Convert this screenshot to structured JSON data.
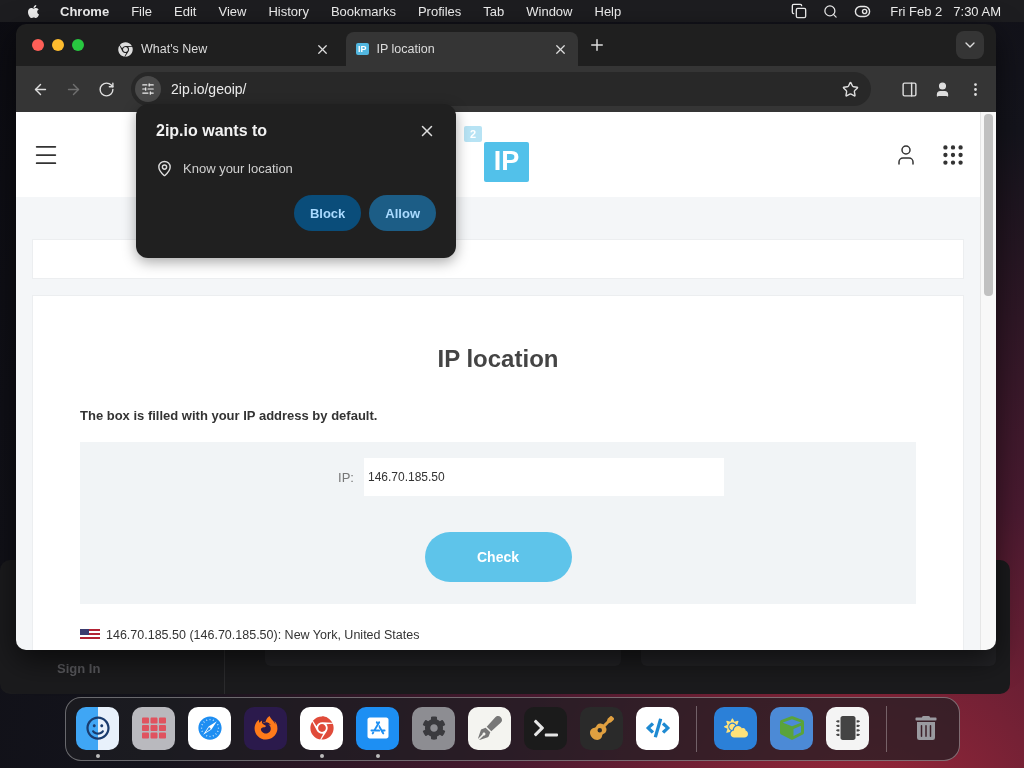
{
  "menubar": {
    "app": "Chrome",
    "menus": [
      "File",
      "Edit",
      "View",
      "History",
      "Bookmarks",
      "Profiles",
      "Tab",
      "Window",
      "Help"
    ],
    "date": "Fri Feb 2",
    "time": "7:30 AM"
  },
  "browser": {
    "tabs": [
      {
        "title": "What's New",
        "selected": false
      },
      {
        "title": "IP location",
        "selected": true,
        "favicon_text": "IP"
      }
    ],
    "nav": [
      {
        "kind": "back",
        "disabled": false
      },
      {
        "kind": "forward",
        "disabled": true
      },
      {
        "kind": "reload",
        "disabled": false
      }
    ],
    "address": "2ip.io/geoip/"
  },
  "permission_prompt": {
    "title": "2ip.io wants to",
    "permission": "Know your location",
    "buttons": [
      {
        "label": "Block",
        "kind": "block"
      },
      {
        "label": "Allow",
        "kind": "allow"
      }
    ]
  },
  "page": {
    "logo": {
      "small": "2",
      "large": "IP"
    },
    "title": "IP location",
    "note": "The box is filled with your IP address by default.",
    "ip_label": "IP:",
    "ip_value": "146.70.185.50",
    "check_button": "Check",
    "result": "146.70.185.50 (146.70.185.50): New York, United States"
  },
  "background_window": {
    "sign_in": "Sign In"
  },
  "dock": {
    "items": [
      {
        "kind": "finder",
        "running": true
      },
      {
        "kind": "launchpad",
        "running": false
      },
      {
        "kind": "safari",
        "running": false
      },
      {
        "kind": "firefox",
        "running": false
      },
      {
        "kind": "chrome",
        "running": true
      },
      {
        "kind": "appstore",
        "running": true
      },
      {
        "kind": "settings",
        "running": false
      },
      {
        "kind": "textedit",
        "running": false
      },
      {
        "kind": "terminal",
        "running": false
      },
      {
        "kind": "garageband",
        "running": false
      },
      {
        "kind": "vscode",
        "running": false
      },
      {
        "kind": "separator"
      },
      {
        "kind": "weather",
        "running": false
      },
      {
        "kind": "minecraft",
        "running": false
      },
      {
        "kind": "sysinfo",
        "running": false
      },
      {
        "kind": "separator"
      },
      {
        "kind": "trash",
        "running": false
      }
    ]
  }
}
